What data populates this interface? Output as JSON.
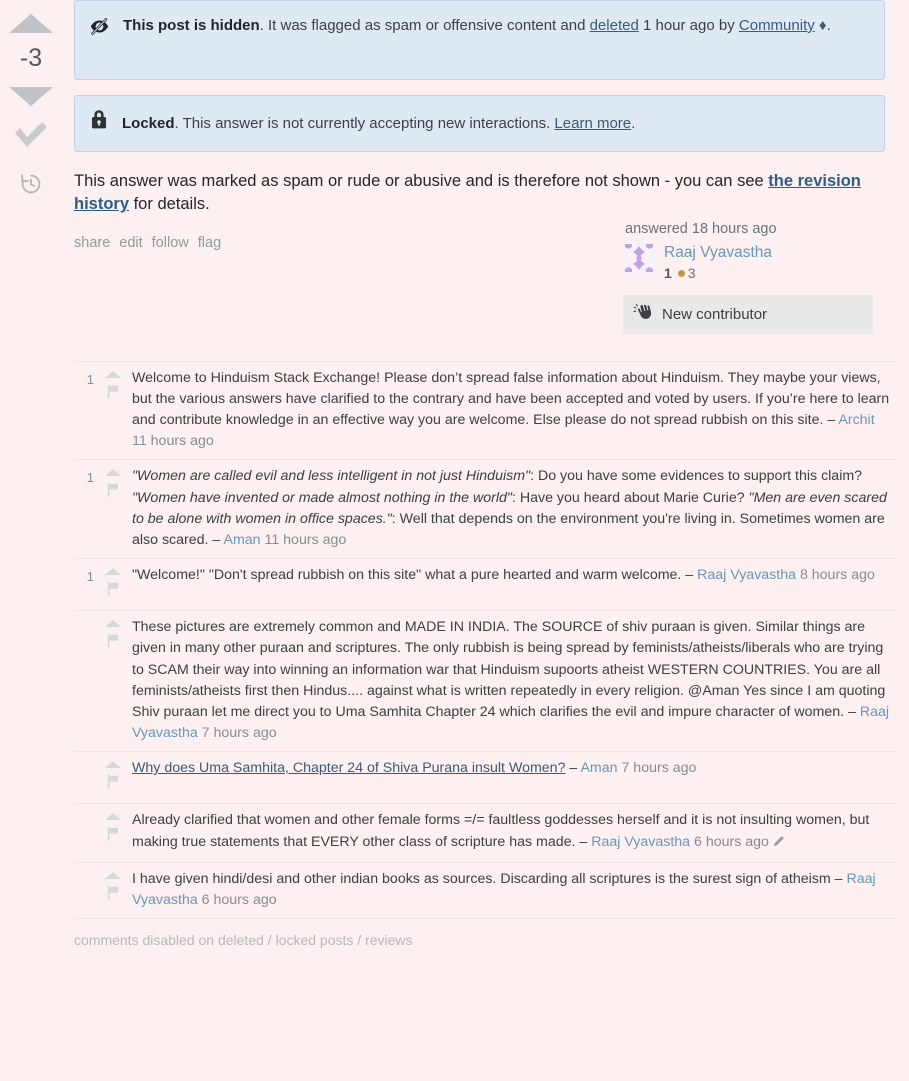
{
  "votes": {
    "score": "-3",
    "upvote_label": "Up vote",
    "downvote_label": "Down vote",
    "accepted_label": "Accepted answer",
    "history_label": "Post history"
  },
  "notices": [
    {
      "id": "hidden",
      "icon": "eye-off-icon",
      "bold": "This post is hidden",
      "text_1": ". It was flagged as spam or offensive content and ",
      "link_1": "deleted",
      "text_2": " 1 hour ago by ",
      "link_2": "Community",
      "diamond": " ♦",
      "text_3": "."
    },
    {
      "id": "locked",
      "icon": "lock-icon",
      "bold": "Locked",
      "text_1": ". This answer is not currently accepting new interactions. ",
      "link_1": "Learn more",
      "text_2": ".",
      "link_2": "",
      "diamond": "",
      "text_3": ""
    }
  ],
  "post": {
    "body_before": "This answer was marked as spam or rude or abusive and is therefore not shown - you can see ",
    "body_link": "the revision history",
    "body_after": " for details."
  },
  "post_menu": [
    "share",
    "edit",
    "follow",
    "flag"
  ],
  "signature": {
    "action_time": "answered 18 hours ago",
    "avatar_name": "identicon-avatar",
    "user_name": "Raaj Vyavastha",
    "reputation": "1",
    "bronze_badges": "3",
    "new_contributor_label": "New contributor",
    "wave_icon": "waving-hand-icon",
    "avatar_color": "#c2a3de"
  },
  "comments": [
    {
      "score": "1",
      "parts": [
        {
          "t": "text",
          "v": "Welcome to Hinduism Stack Exchange! Please don’t spread false information about Hinduism. They maybe your views, but the various answers have clarified to the contrary and have been accepted and voted by users. If you’re here to learn and contribute knowledge in an effective way you are welcome. Else please do not spread rubbish on this site. – "
        },
        {
          "t": "user",
          "v": "Archit"
        },
        {
          "t": "date",
          "v": " 11 hours ago"
        }
      ]
    },
    {
      "score": "1",
      "parts": [
        {
          "t": "em",
          "v": "\"Women are called evil and less intelligent in not just Hinduism\""
        },
        {
          "t": "text",
          "v": ": Do you have some evidences to support this claim? "
        },
        {
          "t": "em",
          "v": "\"Women have invented or made almost nothing in the world\""
        },
        {
          "t": "text",
          "v": ": Have you heard about Marie Curie? "
        },
        {
          "t": "em",
          "v": "\"Men are even scared to be alone with women in office spaces.\""
        },
        {
          "t": "text",
          "v": ": Well that depends on the environment you're living in. Sometimes women are also scared. – "
        },
        {
          "t": "user",
          "v": "Aman"
        },
        {
          "t": "date",
          "v": " 11 hours ago"
        }
      ]
    },
    {
      "score": "1",
      "parts": [
        {
          "t": "text",
          "v": "\"Welcome!\" \"Don't spread rubbish on this site\" what a pure hearted and warm welcome. – "
        },
        {
          "t": "user",
          "v": "Raaj Vyavastha"
        },
        {
          "t": "date",
          "v": " 8 hours ago"
        }
      ]
    },
    {
      "score": "",
      "parts": [
        {
          "t": "text",
          "v": "These pictures are extremely common and MADE IN INDIA. The SOURCE of shiv puraan is given. Similar things are given in many other puraan and scriptures. The only rubbish is being spread by feminists/atheists/liberals who are trying to SCAM their way into winning an information war that Hinduism supoorts atheist WESTERN COUNTRIES. You are all feminists/atheists first then Hindus.... against what is written repeatedly in every religion. @Aman Yes since I am quoting Shiv puraan let me direct you to Uma Samhita Chapter 24 which clarifies the evil and impure character of women. – "
        },
        {
          "t": "user",
          "v": "Raaj Vyavastha"
        },
        {
          "t": "date",
          "v": " 7 hours ago"
        }
      ]
    },
    {
      "score": "",
      "parts": [
        {
          "t": "link",
          "v": "Why does Uma Samhita, Chapter 24 of Shiva Purana insult Women?"
        },
        {
          "t": "text",
          "v": " – "
        },
        {
          "t": "user",
          "v": "Aman"
        },
        {
          "t": "date",
          "v": " 7 hours ago"
        }
      ]
    },
    {
      "score": "",
      "parts": [
        {
          "t": "text",
          "v": "Already clarified that women and other female forms =/= faultless goddesses herself and it is not insulting women, but making true statements that EVERY other class of scripture has made. – "
        },
        {
          "t": "user",
          "v": "Raaj Vyavastha"
        },
        {
          "t": "date",
          "v": " 6 hours ago"
        },
        {
          "t": "pencil",
          "v": "edit-pencil-icon"
        }
      ]
    },
    {
      "score": "",
      "parts": [
        {
          "t": "text",
          "v": "I have given hindi/desi and other indian books as sources. Discarding all scriptures is the surest sign of atheism – "
        },
        {
          "t": "user",
          "v": "Raaj Vyavastha"
        },
        {
          "t": "date",
          "v": " 6 hours ago"
        }
      ]
    }
  ],
  "comments_footer": "comments disabled on deleted / locked posts / reviews"
}
